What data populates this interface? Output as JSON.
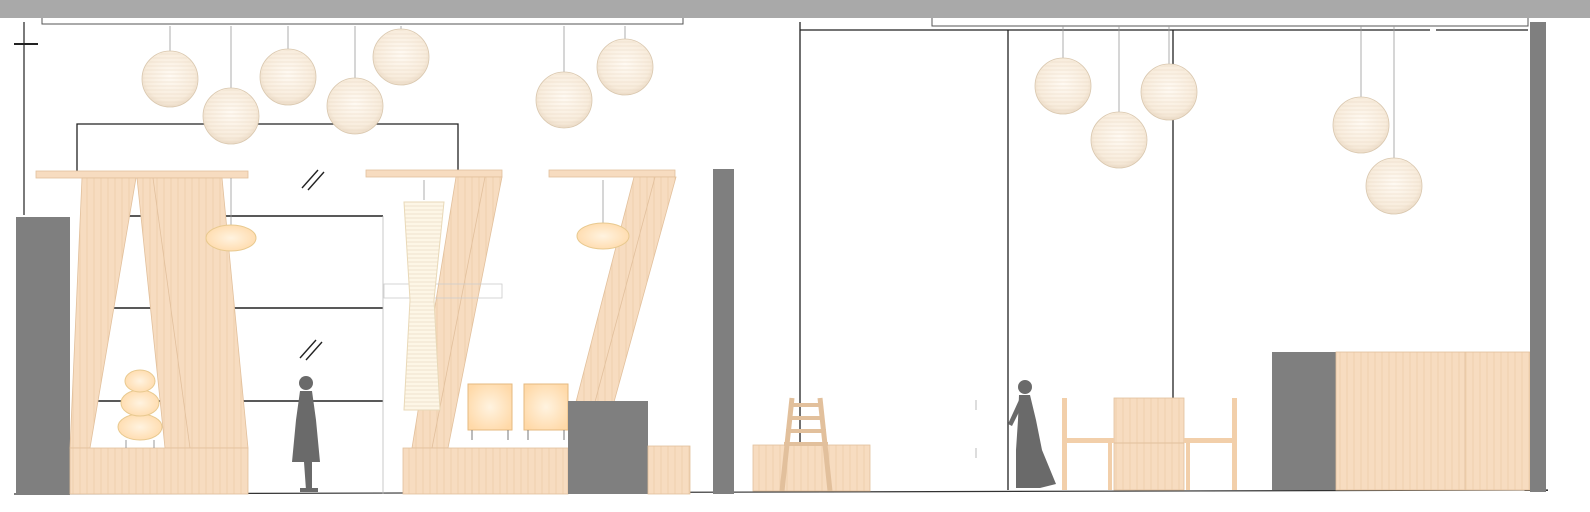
{
  "drawing": {
    "type": "interior-elevation",
    "palette": {
      "wood": "#f7dcc0",
      "wood_edge": "#e2c09c",
      "wood_grain": "#ecc9a4",
      "wall_grey": "#7f7f7f",
      "ceiling_band": "#a9a9a9",
      "silhouette": "#6a6a6a",
      "lantern": "#fbf1e4",
      "lantern_glow": "#ffe3b8",
      "line": "#222222"
    }
  },
  "icons": {
    "pendant": "paper-lantern-pendant-icon",
    "figure": "person-silhouette-icon",
    "glass": "glass-hatch-icon"
  }
}
